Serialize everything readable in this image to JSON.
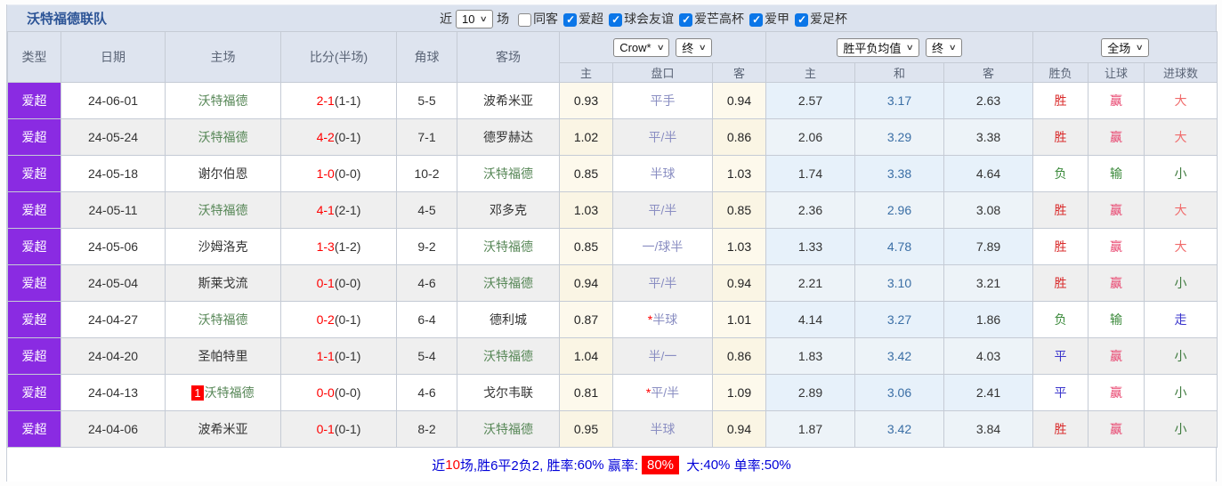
{
  "colors": {
    "type_badge_purple": "#8a2be2",
    "title_bar_blue": "#dbe2ee",
    "header_cell_blue": "#dee4ef",
    "crow_odds_cream": "#fdf9ec",
    "europe_odds_blue": "#e7f1fa",
    "win_red": "#d92b2b",
    "lose_green": "#3d8b3d",
    "draw_blue": "#3a35cc",
    "watford_green": "#578757",
    "footer_blue": "#0000d8",
    "highlight_red": "#ff0000"
  },
  "header": {
    "team_title": "沃特福德联队",
    "near_label": "近",
    "near_select": "10",
    "games_label": "场",
    "filters": [
      {
        "label": "同客",
        "checked": false
      },
      {
        "label": "爱超",
        "checked": true
      },
      {
        "label": "球会友谊",
        "checked": true
      },
      {
        "label": "爱芒高杯",
        "checked": true
      },
      {
        "label": "爱甲",
        "checked": true
      },
      {
        "label": "爱足杯",
        "checked": true
      }
    ]
  },
  "table": {
    "columns": {
      "type": "类型",
      "date": "日期",
      "home": "主场",
      "score": "比分(半场)",
      "corner": "角球",
      "away": "客场"
    },
    "selects": {
      "company": "Crow*",
      "company_time": "终",
      "europe": "胜平负均值",
      "europe_time": "终",
      "scope": "全场"
    },
    "subheaders": [
      "主",
      "盘口",
      "客",
      "主",
      "和",
      "客",
      "胜负",
      "让球",
      "进球数"
    ],
    "rows": [
      {
        "type": "爱超",
        "date": "24-06-01",
        "home": "沃特福德",
        "home_green": true,
        "home_badge": "",
        "score_ft": "2-1",
        "score_ht": "(1-1)",
        "corner": "5-5",
        "away": "波希米亚",
        "away_green": false,
        "crow_home": "0.93",
        "handicap_star": false,
        "handicap": "平手",
        "crow_away": "0.94",
        "eu_home": "2.57",
        "eu_draw": "3.17",
        "eu_away": "2.63",
        "result": {
          "text": "胜",
          "kind": "win"
        },
        "let": {
          "text": "赢",
          "kind": "lwin"
        },
        "goal": {
          "text": "大",
          "kind": "big"
        }
      },
      {
        "type": "爱超",
        "date": "24-05-24",
        "home": "沃特福德",
        "home_green": true,
        "home_badge": "",
        "score_ft": "4-2",
        "score_ht": "(0-1)",
        "corner": "7-1",
        "away": "德罗赫达",
        "away_green": false,
        "crow_home": "1.02",
        "handicap_star": false,
        "handicap": "平/半",
        "crow_away": "0.86",
        "eu_home": "2.06",
        "eu_draw": "3.29",
        "eu_away": "3.38",
        "result": {
          "text": "胜",
          "kind": "win"
        },
        "let": {
          "text": "赢",
          "kind": "lwin"
        },
        "goal": {
          "text": "大",
          "kind": "big"
        }
      },
      {
        "type": "爱超",
        "date": "24-05-18",
        "home": "谢尔伯恩",
        "home_green": false,
        "home_badge": "",
        "score_ft": "1-0",
        "score_ht": "(0-0)",
        "corner": "10-2",
        "away": "沃特福德",
        "away_green": true,
        "crow_home": "0.85",
        "handicap_star": false,
        "handicap": "半球",
        "crow_away": "1.03",
        "eu_home": "1.74",
        "eu_draw": "3.38",
        "eu_away": "4.64",
        "result": {
          "text": "负",
          "kind": "lose"
        },
        "let": {
          "text": "输",
          "kind": "llose"
        },
        "goal": {
          "text": "小",
          "kind": "small"
        }
      },
      {
        "type": "爱超",
        "date": "24-05-11",
        "home": "沃特福德",
        "home_green": true,
        "home_badge": "",
        "score_ft": "4-1",
        "score_ht": "(2-1)",
        "corner": "4-5",
        "away": "邓多克",
        "away_green": false,
        "crow_home": "1.03",
        "handicap_star": false,
        "handicap": "平/半",
        "crow_away": "0.85",
        "eu_home": "2.36",
        "eu_draw": "2.96",
        "eu_away": "3.08",
        "result": {
          "text": "胜",
          "kind": "win"
        },
        "let": {
          "text": "赢",
          "kind": "lwin"
        },
        "goal": {
          "text": "大",
          "kind": "big"
        }
      },
      {
        "type": "爱超",
        "date": "24-05-06",
        "home": "沙姆洛克",
        "home_green": false,
        "home_badge": "",
        "score_ft": "1-3",
        "score_ht": "(1-2)",
        "corner": "9-2",
        "away": "沃特福德",
        "away_green": true,
        "crow_home": "0.85",
        "handicap_star": false,
        "handicap": "一/球半",
        "crow_away": "1.03",
        "eu_home": "1.33",
        "eu_draw": "4.78",
        "eu_away": "7.89",
        "result": {
          "text": "胜",
          "kind": "win"
        },
        "let": {
          "text": "赢",
          "kind": "lwin"
        },
        "goal": {
          "text": "大",
          "kind": "big"
        }
      },
      {
        "type": "爱超",
        "date": "24-05-04",
        "home": "斯莱戈流",
        "home_green": false,
        "home_badge": "",
        "score_ft": "0-1",
        "score_ht": "(0-0)",
        "corner": "4-6",
        "away": "沃特福德",
        "away_green": true,
        "crow_home": "0.94",
        "handicap_star": false,
        "handicap": "平/半",
        "crow_away": "0.94",
        "eu_home": "2.21",
        "eu_draw": "3.10",
        "eu_away": "3.21",
        "result": {
          "text": "胜",
          "kind": "win"
        },
        "let": {
          "text": "赢",
          "kind": "lwin"
        },
        "goal": {
          "text": "小",
          "kind": "small"
        }
      },
      {
        "type": "爱超",
        "date": "24-04-27",
        "home": "沃特福德",
        "home_green": true,
        "home_badge": "",
        "score_ft": "0-2",
        "score_ht": "(0-1)",
        "corner": "6-4",
        "away": "德利城",
        "away_green": false,
        "crow_home": "0.87",
        "handicap_star": true,
        "handicap": "半球",
        "crow_away": "1.01",
        "eu_home": "4.14",
        "eu_draw": "3.27",
        "eu_away": "1.86",
        "result": {
          "text": "负",
          "kind": "lose"
        },
        "let": {
          "text": "输",
          "kind": "llose"
        },
        "goal": {
          "text": "走",
          "kind": "go"
        }
      },
      {
        "type": "爱超",
        "date": "24-04-20",
        "home": "圣帕特里",
        "home_green": false,
        "home_badge": "",
        "score_ft": "1-1",
        "score_ht": "(0-1)",
        "corner": "5-4",
        "away": "沃特福德",
        "away_green": true,
        "crow_home": "1.04",
        "handicap_star": false,
        "handicap": "半/一",
        "crow_away": "0.86",
        "eu_home": "1.83",
        "eu_draw": "3.42",
        "eu_away": "4.03",
        "result": {
          "text": "平",
          "kind": "draw"
        },
        "let": {
          "text": "赢",
          "kind": "lwin"
        },
        "goal": {
          "text": "小",
          "kind": "small"
        }
      },
      {
        "type": "爱超",
        "date": "24-04-13",
        "home": "沃特福德",
        "home_green": true,
        "home_badge": "1",
        "score_ft": "0-0",
        "score_ht": "(0-0)",
        "corner": "4-6",
        "away": "戈尔韦联",
        "away_green": false,
        "crow_home": "0.81",
        "handicap_star": true,
        "handicap": "平/半",
        "crow_away": "1.09",
        "eu_home": "2.89",
        "eu_draw": "3.06",
        "eu_away": "2.41",
        "result": {
          "text": "平",
          "kind": "draw"
        },
        "let": {
          "text": "赢",
          "kind": "lwin"
        },
        "goal": {
          "text": "小",
          "kind": "small"
        }
      },
      {
        "type": "爱超",
        "date": "24-04-06",
        "home": "波希米亚",
        "home_green": false,
        "home_badge": "",
        "score_ft": "0-1",
        "score_ht": "(0-1)",
        "corner": "8-2",
        "away": "沃特福德",
        "away_green": true,
        "crow_home": "0.95",
        "handicap_star": false,
        "handicap": "半球",
        "crow_away": "0.94",
        "eu_home": "1.87",
        "eu_draw": "3.42",
        "eu_away": "3.84",
        "result": {
          "text": "胜",
          "kind": "win"
        },
        "let": {
          "text": "赢",
          "kind": "lwin"
        },
        "goal": {
          "text": "小",
          "kind": "small"
        }
      }
    ]
  },
  "footer": {
    "near_label": "近",
    "near_count": "10",
    "record_text": "场,胜6平2负2, 胜率:",
    "win_rate": "60%",
    "let_label": " 赢率:",
    "let_rate": "80%",
    "big_label": " 大:",
    "big_rate": "40%",
    "single_label": " 单率:",
    "single_rate": "50%"
  }
}
